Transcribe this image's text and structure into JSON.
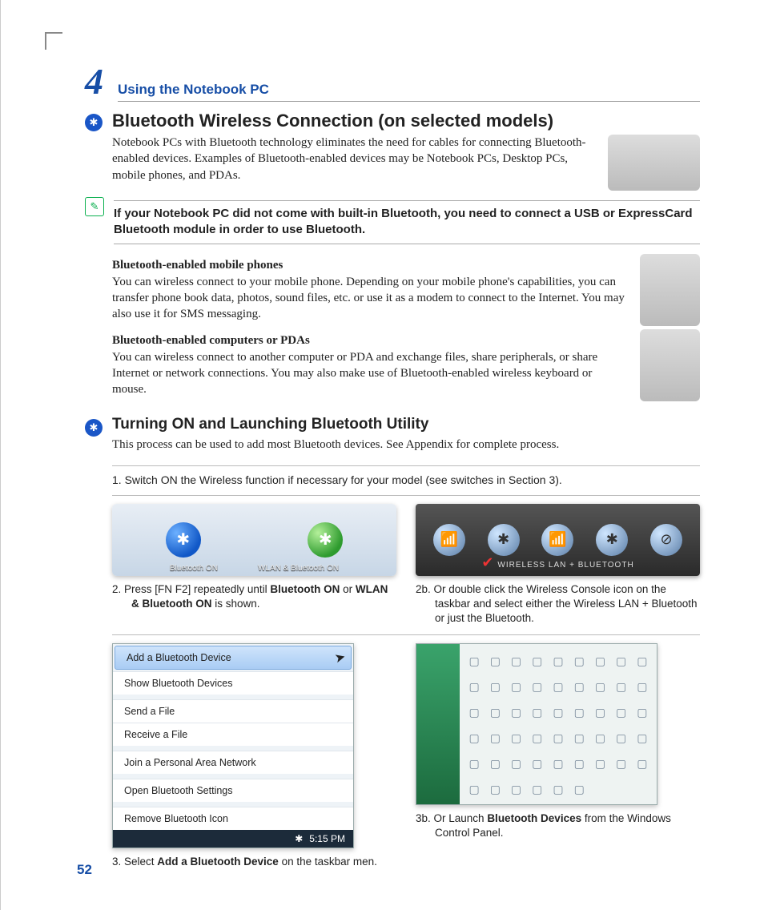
{
  "chapter": {
    "number": "4",
    "title": "Using the Notebook PC"
  },
  "section1": {
    "heading": "Bluetooth Wireless Connection (on selected models)",
    "intro": "Notebook PCs with Bluetooth technology eliminates the need for cables for connecting Bluetooth-enabled devices. Examples of Bluetooth-enabled devices may be Notebook PCs, Desktop PCs, mobile phones, and PDAs."
  },
  "note": "If your Notebook PC did not come with built-in Bluetooth, you need to connect a USB or ExpressCard Bluetooth module in order to use Bluetooth.",
  "sub1": {
    "title": "Bluetooth-enabled mobile phones",
    "text": "You can wireless connect to your mobile phone. Depending on your mobile phone's capabilities, you can transfer phone book data, photos, sound files, etc. or use it as a modem to connect to the Internet. You may also use it for SMS messaging."
  },
  "sub2": {
    "title": "Bluetooth-enabled computers or PDAs",
    "text": "You can wireless connect to another computer or PDA and exchange files, share peripherals, or share Internet or network connections. You may also make use of Bluetooth-enabled wireless keyboard or mouse."
  },
  "section2": {
    "heading": "Turning ON and Launching Bluetooth Utility",
    "intro": "This process can be used to add most Bluetooth devices. See Appendix for complete process."
  },
  "steps": {
    "s1": "1.   Switch ON the Wireless function if necessary for your model (see switches in Section 3).",
    "s2_pre": "2.   Press [FN F2] repeatedly until ",
    "s2_b1": "Bluetooth ON",
    "s2_mid": " or ",
    "s2_b2": "WLAN & Bluetooth ON",
    "s2_post": " is shown.",
    "s2b_pre": "2b. Or double click the Wireless Console icon on the taskbar and select either the Wireless LAN + Bluetooth or just the Bluetooth.",
    "s3_pre": "3.   Select ",
    "s3_b": "Add a Bluetooth Device",
    "s3_post": " on the taskbar men.",
    "s3b_pre": "3b. Or Launch ",
    "s3b_b": "Bluetooth Devices",
    "s3b_post": " from the Windows Control Panel."
  },
  "shot1": {
    "label_a": "Bluetooth ON",
    "label_b": "WLAN & Bluetooth ON"
  },
  "shot2": {
    "label": "Wireless LAN + Bluetooth"
  },
  "menu": {
    "items": [
      "Add a Bluetooth Device",
      "Show Bluetooth Devices",
      "Send a File",
      "Receive a File",
      "Join a Personal Area Network",
      "Open Bluetooth Settings",
      "Remove Bluetooth Icon"
    ],
    "time": "5:15 PM"
  },
  "page_number": "52"
}
